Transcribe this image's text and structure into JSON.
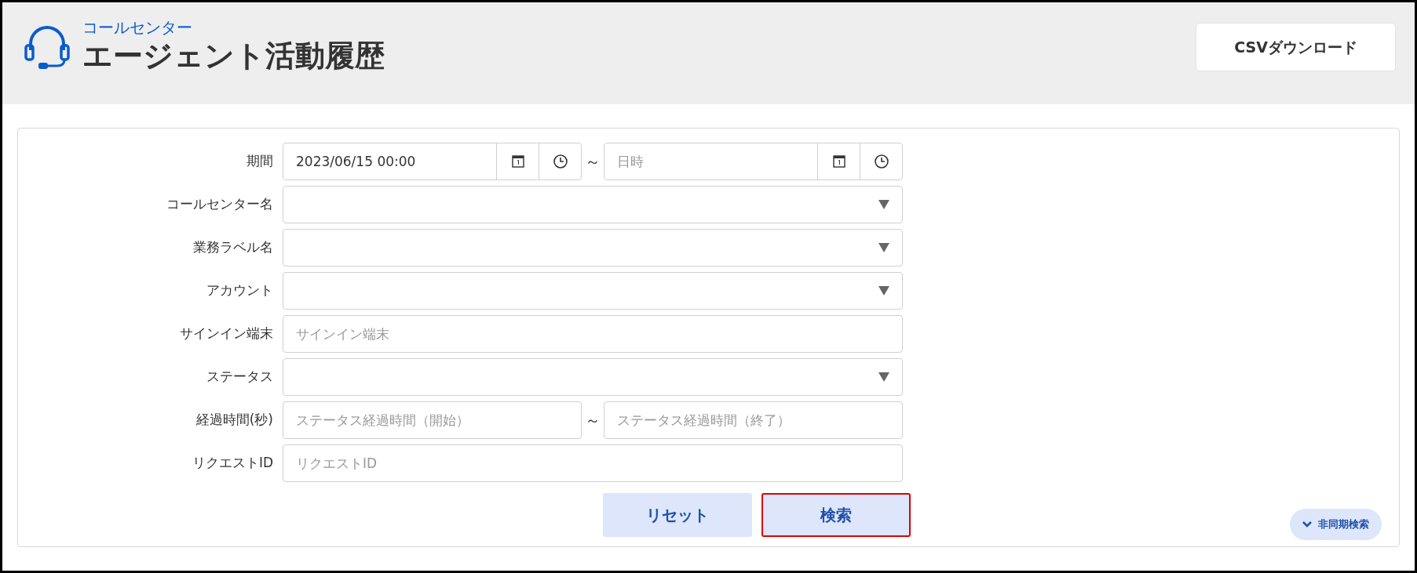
{
  "header": {
    "subtitle": "コールセンター",
    "title": "エージェント活動履歴",
    "csv_button": "CSVダウンロード"
  },
  "fields": [
    {
      "kind": "datetime_range",
      "label": "期間",
      "from": {
        "value": "2023/06/15 00:00"
      },
      "to": {
        "placeholder": "日時"
      },
      "separator": "～"
    },
    {
      "kind": "select",
      "label": "コールセンター名"
    },
    {
      "kind": "select",
      "label": "業務ラベル名"
    },
    {
      "kind": "select",
      "label": "アカウント"
    },
    {
      "kind": "text",
      "label": "サインイン端末",
      "placeholder": "サインイン端末"
    },
    {
      "kind": "select",
      "label": "ステータス"
    },
    {
      "kind": "range",
      "label": "経過時間(秒)",
      "from": {
        "placeholder": "ステータス経過時間（開始）"
      },
      "to": {
        "placeholder": "ステータス経過時間（終了）"
      },
      "separator": "～"
    },
    {
      "kind": "text",
      "label": "リクエストID",
      "placeholder": "リクエストID"
    }
  ],
  "buttons": [
    {
      "label": "リセット",
      "highlighted": false
    },
    {
      "label": "検索",
      "highlighted": true
    }
  ],
  "async_search": {
    "label": "非同期検索"
  }
}
